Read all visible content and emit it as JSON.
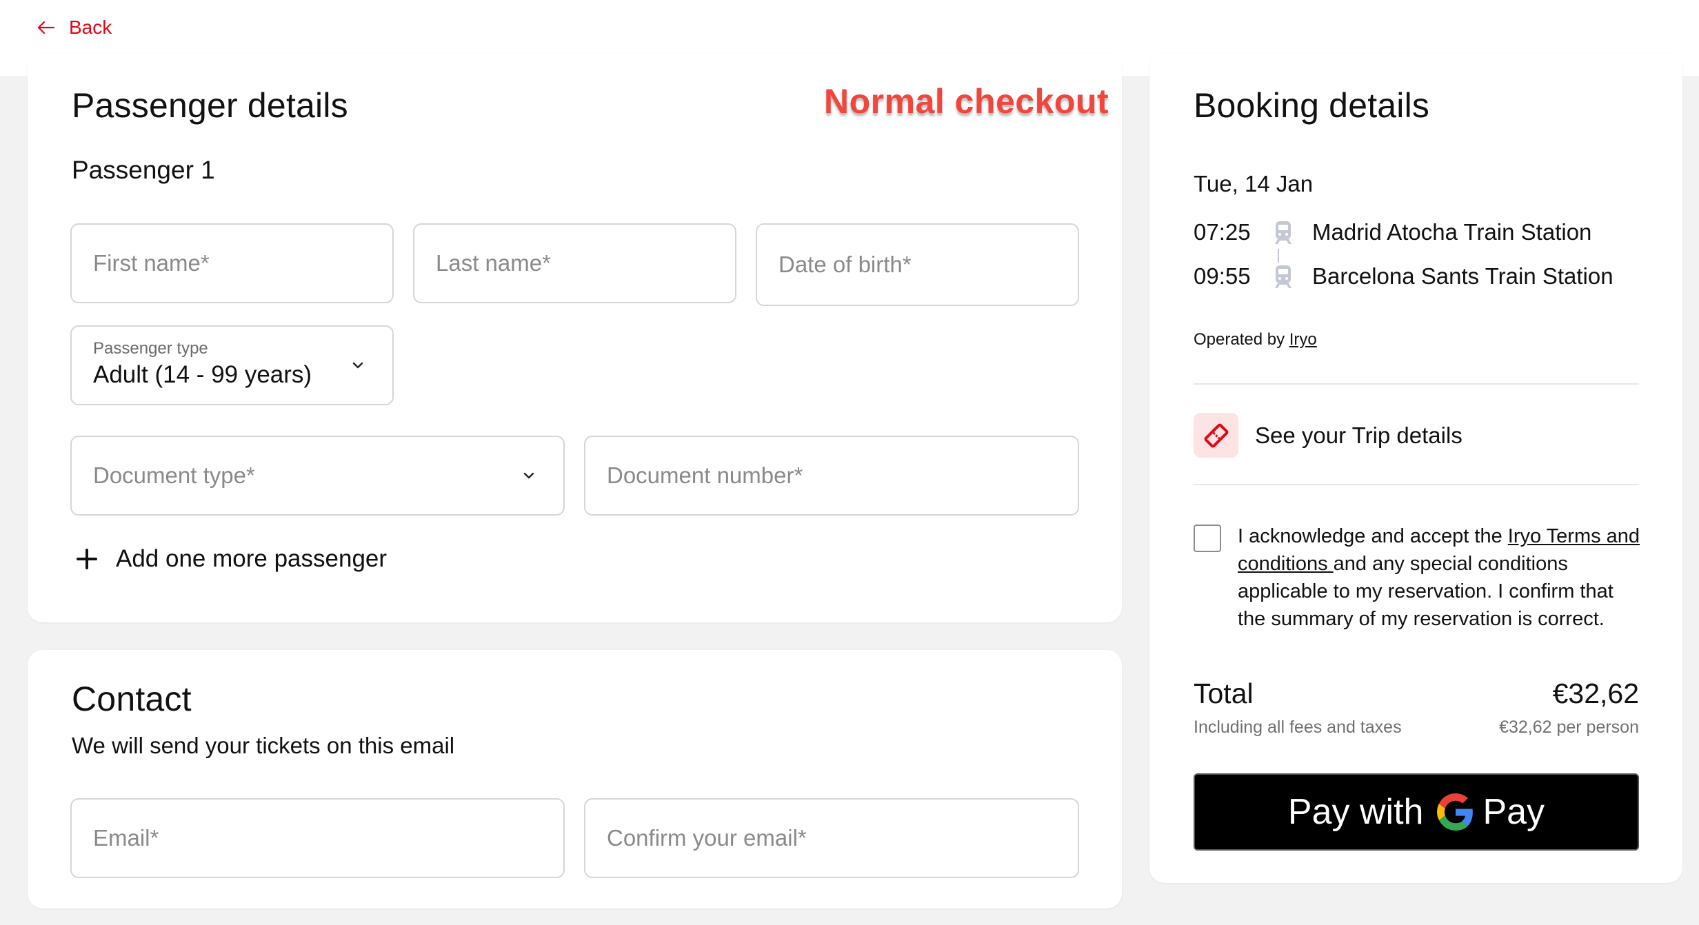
{
  "nav": {
    "back_label": "Back"
  },
  "annotation": "Normal checkout",
  "passenger": {
    "title": "Passenger details",
    "subtitle": "Passenger 1",
    "first_name_placeholder": "First name*",
    "last_name_placeholder": "Last name*",
    "dob_placeholder": "Date of birth*",
    "type_label": "Passenger type",
    "type_value": "Adult (14 - 99 years)",
    "doc_type_placeholder": "Document type*",
    "doc_number_placeholder": "Document number*",
    "add_label": "Add one more passenger"
  },
  "contact": {
    "title": "Contact",
    "subtitle": "We will send your tickets on this email",
    "email_placeholder": "Email*",
    "confirm_placeholder": "Confirm your email*"
  },
  "booking": {
    "title": "Booking details",
    "date": "Tue, 14 Jan",
    "departure_time": "07:25",
    "departure_station": "Madrid Atocha Train Station",
    "arrival_time": "09:55",
    "arrival_station": "Barcelona Sants Train Station",
    "operated_prefix": "Operated by",
    "operator": "Iryo",
    "trip_details_label": "See your Trip details",
    "terms_before": "I acknowledge and accept the ",
    "terms_link": "Iryo Terms and conditions ",
    "terms_after": "and any special conditions applicable to my reservation. I confirm that the summary of my reservation is correct.",
    "total_label": "Total",
    "total_price": "€32,62",
    "fees_label": "Including all fees and taxes",
    "per_person": "€32,62 per person",
    "pay_with": "Pay with",
    "pay_word": "Pay"
  },
  "colors": {
    "accent": "#e30613",
    "annotation": "#f2463c",
    "ticket_bg": "#fde4e4",
    "train_icon": "#c4c7d4"
  }
}
